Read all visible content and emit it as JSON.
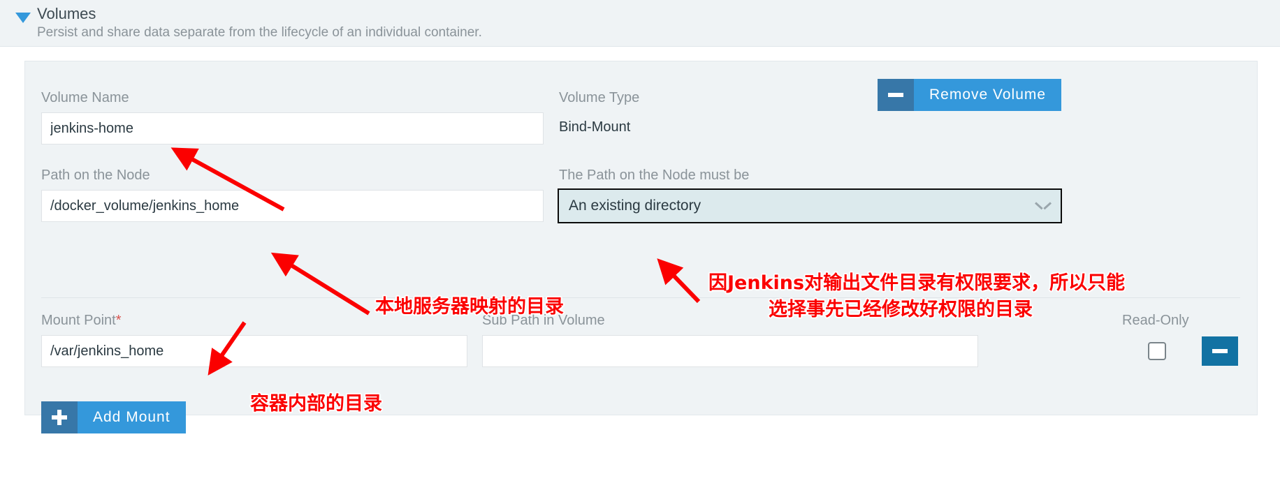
{
  "header": {
    "title": "Volumes",
    "subtitle": "Persist and share data separate from the lifecycle of an individual container.",
    "collapse_icon": "triangle-down-icon"
  },
  "volume": {
    "name_label": "Volume Name",
    "name_value": "jenkins-home",
    "type_label": "Volume Type",
    "type_value": "Bind-Mount",
    "node_path_label": "Path on the Node",
    "node_path_value": "/docker_volume/jenkins_home",
    "node_path_rule_label": "The Path on the Node must be",
    "node_path_rule_value": "An existing directory",
    "remove_volume_label": "Remove Volume",
    "remove_volume_icon": "minus-icon",
    "dropdown_icon": "chevron-down-icon"
  },
  "mount": {
    "mount_point_label": "Mount Point",
    "mount_point_required_mark": "*",
    "mount_point_value": "/var/jenkins_home",
    "sub_path_label": "Sub Path in Volume",
    "sub_path_value": "",
    "sub_path_placeholder": "",
    "read_only_label": "Read-Only",
    "read_only_checked": false,
    "remove_mount_icon": "minus-icon",
    "add_mount_label": "Add Mount",
    "add_mount_icon": "plus-icon"
  },
  "annotations": [
    {
      "id": "anno-node-path",
      "text": "本地服务器映射的目录"
    },
    {
      "id": "anno-rule-line1",
      "text": "因Jenkins对输出文件目录有权限要求，所以只能"
    },
    {
      "id": "anno-rule-line2",
      "text": "选择事先已经修改好权限的目录"
    },
    {
      "id": "anno-mount-point",
      "text": "容器内部的目录"
    }
  ],
  "colors": {
    "accent_blue": "#3498db",
    "accent_blue_dark": "#3777a8",
    "icon_btn_blue": "#1272a3",
    "panel_bg": "#eff3f5",
    "label_gray": "#8a9399",
    "annotation_red": "#fb0000",
    "required_red": "#d9534f"
  }
}
